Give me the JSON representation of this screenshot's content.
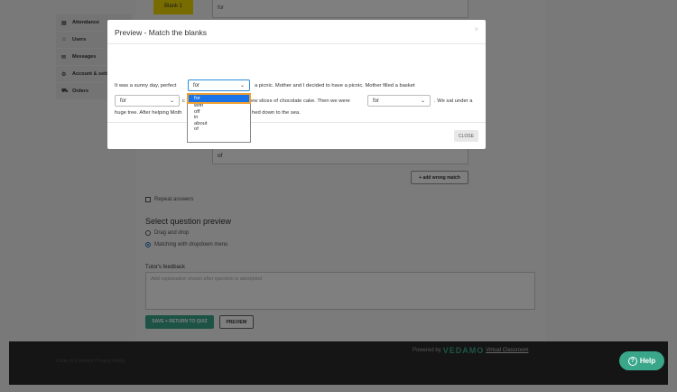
{
  "sidebar": {
    "items": [
      {
        "icon": "document-icon",
        "glyph": "▤",
        "label": "Attendance"
      },
      {
        "icon": "users-icon",
        "glyph": "👥",
        "label": "Users"
      },
      {
        "icon": "mail-icon",
        "glyph": "✉",
        "label": "Messages"
      },
      {
        "icon": "gear-icon",
        "glyph": "⚙",
        "label": "Account & sett"
      },
      {
        "icon": "cart-icon",
        "glyph": "🛒",
        "label": "Orders"
      }
    ]
  },
  "editor": {
    "blank_label": "Blank 1",
    "top_field_value": "for",
    "of_field_value": "of",
    "add_wrong_label": "+ add wrong match",
    "repeat_label": "Repeat answers",
    "preview_heading": "Select question preview",
    "preview_options": [
      {
        "label": "Drag and drop",
        "selected": false
      },
      {
        "label": "Matching with dropdown menu",
        "selected": true
      }
    ],
    "feedback_label": "Tutor's feedback",
    "feedback_placeholder": "Add explanation shown after question is attempted",
    "save_label": "SAVE + RETURN TO QUIZ",
    "preview_label": "PREVIEW"
  },
  "footer": {
    "links": "Code of Conduct  Privacy Policy",
    "powered_by": "Powered by",
    "brand": "VEDAMO",
    "virtual_classroom": "Virtual Classroom"
  },
  "help": {
    "label": "Help"
  },
  "modal": {
    "title": "Preview - Match the blanks",
    "close_x": "×",
    "line1_pre": "It was a sunny day, perfect",
    "dd1_value": "for",
    "line1_post": "a picnic. Mother and I decided to have a picnic. Mother filled a basket",
    "dd2_value": "for",
    "line2_mid": "ew slices of chocolate cake. Then we were",
    "dd3_value": "for",
    "line2_post": ". We sat under a",
    "line3_pre": "huge tree. After helping Moth",
    "line3_post": "hed down to the sea.",
    "close_button": "CLOSE",
    "dropdown_options": [
      "for",
      "with",
      "off",
      "in",
      "about",
      "of"
    ],
    "dropdown_selected": "for"
  },
  "colors": {
    "accent": "#3aa78a",
    "select_highlight": "#1a73e8",
    "blank_badge": "#f0d800"
  }
}
